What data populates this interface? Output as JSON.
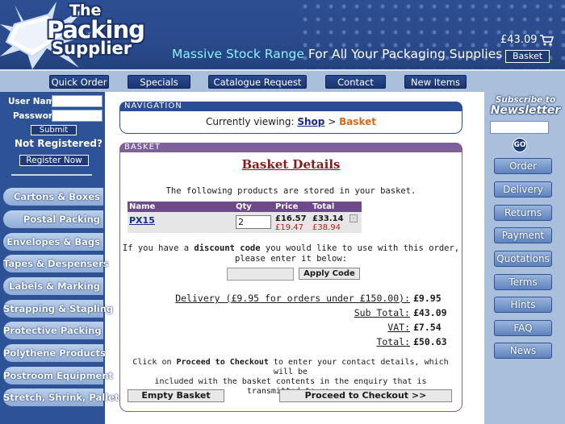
{
  "header": {
    "logo_line1": "The",
    "logo_line2": "Packing",
    "logo_line3": "Supplier",
    "tagline_part1": "Massive Stock Range ",
    "tagline_part2": "For All Your Packaging Supplies",
    "cart_total": "£43.09",
    "basket_button": "Basket",
    "cart_icon": "shopping-cart-icon"
  },
  "nav": {
    "items": [
      "Quick Order",
      "Specials",
      "Catalogue Request",
      "Contact",
      "New Items"
    ]
  },
  "login": {
    "username_label": "User Name",
    "password_label": "Password",
    "submit_label": "Submit",
    "not_registered": "Not Registered?",
    "register_label": "Register Now"
  },
  "categories": [
    "Cartons & Boxes",
    "Postal Packing",
    "Envelopes & Bags",
    "Tapes & Despensers",
    "Labels & Marking",
    "Strapping & Stapling",
    "Protective Packing",
    "Polythene Products",
    "Postroom Equipment",
    "Stretch, Shrink, Pallet"
  ],
  "right": {
    "subscribe_label": "Subscribe to",
    "newsletter_label": "Newsletter",
    "go_label": "GO",
    "links": [
      "Order",
      "Delivery",
      "Returns",
      "Payment",
      "Quotations",
      "Terms",
      "Hints",
      "FAQ",
      "News"
    ]
  },
  "navigation_panel": {
    "heading": "NAVIGATION",
    "viewing_prefix": "Currently viewing: ",
    "crumb_shop": "Shop",
    "separator": " > ",
    "crumb_basket": "Basket"
  },
  "basket": {
    "heading": "BASKET",
    "title": "Basket Details",
    "intro": "The following products are stored in your basket.",
    "columns": [
      "Name",
      "Qty",
      "Price",
      "Total"
    ],
    "items": [
      {
        "name": "PX15",
        "qty": "2",
        "price_ex": "£16.57",
        "price_inc": "£19.47",
        "total_ex": "£33.14",
        "total_inc": "£38.94"
      }
    ],
    "discount_line1_pre": "If you have a ",
    "discount_line1_bold": "discount code",
    "discount_line1_post": " you would like to use with this order,",
    "discount_line2": "please enter it below:",
    "discount_value": "",
    "apply_label": "Apply Code",
    "delivery_label": "Delivery (£9.95 for orders under £150.00):",
    "delivery_value": "£9.95",
    "subtotal_label": "Sub Total:",
    "subtotal_value": "£43.09",
    "vat_label": "VAT:",
    "vat_value": "£7.54",
    "total_label": "Total:",
    "total_value": "£50.63",
    "checkout_text_pre": "Click on ",
    "checkout_text_bold": "Proceed to Checkout",
    "checkout_text_post": " to enter your contact details, which will be",
    "checkout_text_line2": "included with the basket contents in the enquiry that is transmitted to us.",
    "empty_label": "Empty Basket",
    "checkout_label": "Proceed to Checkout >>"
  }
}
